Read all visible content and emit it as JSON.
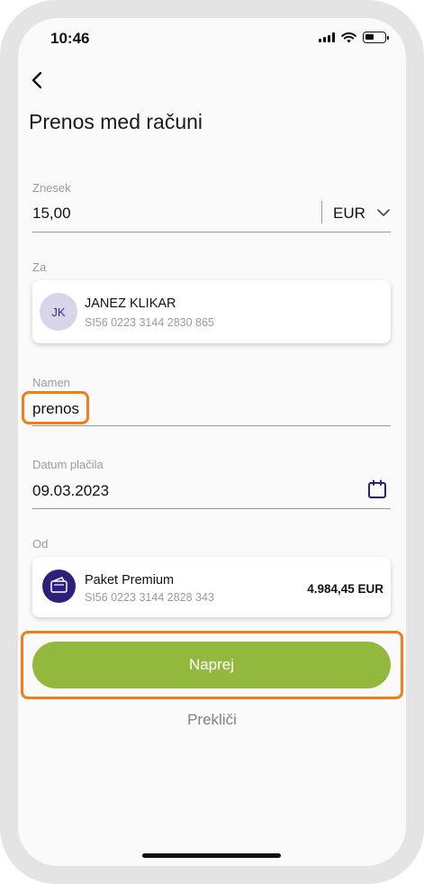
{
  "status_bar": {
    "time": "10:46",
    "icons": [
      "signal-icon",
      "wifi-icon",
      "battery-icon"
    ]
  },
  "header": {
    "title": "Prenos med računi",
    "back_icon": "chevron-left-icon"
  },
  "amount": {
    "label": "Znesek",
    "value": "15,00",
    "currency": "EUR"
  },
  "recipient": {
    "label": "Za",
    "initials": "JK",
    "name": "JANEZ KLIKAR",
    "iban": "SI56 0223 3144 2830 865"
  },
  "purpose": {
    "label": "Namen",
    "value": "prenos"
  },
  "payment_date": {
    "label": "Datum plačila",
    "value": "09.03.2023",
    "icon": "calendar-icon"
  },
  "source": {
    "label": "Od",
    "account_name": "Paket Premium",
    "iban": "SI56 0223 3144 2828 343",
    "balance": "4.984,45 EUR",
    "icon": "wallet-icon"
  },
  "actions": {
    "primary_label": "Naprej",
    "cancel_label": "Prekliči"
  },
  "colors": {
    "primary_button": "#93b83e",
    "highlight": "#f07d1a",
    "brand_purple": "#2e1f7a",
    "avatar_bg": "#d9d4ea"
  }
}
